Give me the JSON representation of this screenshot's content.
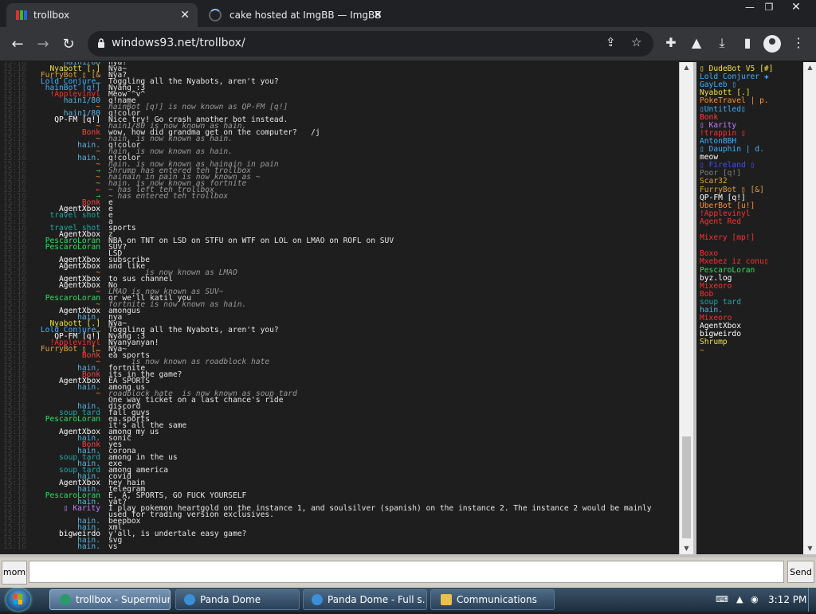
{
  "browser": {
    "tabs": [
      {
        "title": "trollbox",
        "active": true
      },
      {
        "title": "cake hosted at ImgBB — ImgBB",
        "active": false
      }
    ],
    "url": "windows93.net/trollbox/"
  },
  "chat": {
    "timestamp_placeholder": "15:16",
    "messages": [
      {
        "nick": "hain1/80",
        "color": "#5ab4e0",
        "text": "nya!"
      },
      {
        "nick": "Nyabott [.]",
        "color": "#f0e040",
        "text": "Nya~"
      },
      {
        "nick": "FurryBot ▯ [&",
        "color": "#e0a040",
        "text": "Nya?"
      },
      {
        "nick": "Lold Conjure…",
        "color": "#40b0ff",
        "text": "Toggling all the Nyabots, aren't you?"
      },
      {
        "nick": "hainBot [q!]",
        "color": "#40b0ff",
        "text": "Nyang :3"
      },
      {
        "nick": "!Applevinyl",
        "color": "#ff3030",
        "text": "Meow ^v^"
      },
      {
        "nick": "hain1/80",
        "color": "#5ab4e0",
        "text": "q!name"
      },
      {
        "nick": "~",
        "color": "#ff8c2a",
        "text": "hainBot [q!] is now known as QP-FM [q!]",
        "system": true
      },
      {
        "nick": "hain1/80",
        "color": "#5ab4e0",
        "text": "q!color"
      },
      {
        "nick": "QP-FM [q!]",
        "color": "#ffffff",
        "text": "Nice try! Go crash another bot instead."
      },
      {
        "nick": "~",
        "color": "#ff8c2a",
        "text": "hain1/80 is now known as hain.",
        "system": true
      },
      {
        "nick": "Bonk",
        "color": "#ff4040",
        "text": "wow, how did grandma get on the computer?   /j"
      },
      {
        "nick": "~",
        "color": "#ff8c2a",
        "text": "hain. is now known as hain.",
        "system": true
      },
      {
        "nick": "hain.",
        "color": "#5ab4e0",
        "text": "q!color"
      },
      {
        "nick": "~",
        "color": "#ff8c2a",
        "text": "hain. is now known as hain.",
        "system": true
      },
      {
        "nick": "hain.",
        "color": "#5ab4e0",
        "text": "q!color"
      },
      {
        "nick": "~",
        "color": "#ff8c2a",
        "text": "hain. is now known as hainain in pain",
        "system": true
      },
      {
        "nick": "→",
        "color": "#40d040",
        "text": "Shrump has entered teh trollbox",
        "system": true
      },
      {
        "nick": "~",
        "color": "#ff8c2a",
        "text": "hainain in pain is now known as ~",
        "system": true
      },
      {
        "nick": "~",
        "color": "#ff8c2a",
        "text": "hain. is now known as fortnite",
        "system": true
      },
      {
        "nick": "←",
        "color": "#ff4040",
        "text": "~ has left teh trollbox",
        "system": true
      },
      {
        "nick": "→",
        "color": "#40d040",
        "text": "~ has entered teh trollbox",
        "system": true
      },
      {
        "nick": "Bonk",
        "color": "#ff4040",
        "text": "e"
      },
      {
        "nick": "AgentXbox",
        "color": "#ffffff",
        "text": "e"
      },
      {
        "nick": "travel shot",
        "color": "#20a8a8",
        "text": "e"
      },
      {
        "nick": "",
        "color": "#3050e0",
        "text": "a"
      },
      {
        "nick": "travel shot",
        "color": "#20a8a8",
        "text": "sports"
      },
      {
        "nick": "AgentXbox",
        "color": "#ffffff",
        "text": "z"
      },
      {
        "nick": "PescaroLoran",
        "color": "#30e060",
        "text": "NBA on TNT on LSD on STFU on WTF on LOL on LMAO on ROFL on SUV"
      },
      {
        "nick": "PescaroLoran",
        "color": "#30e060",
        "text": "SUV?"
      },
      {
        "nick": "",
        "color": "#3050e0",
        "text": "LSD"
      },
      {
        "nick": "AgentXbox",
        "color": "#ffffff",
        "text": "subscribe"
      },
      {
        "nick": "AgentXbox",
        "color": "#ffffff",
        "text": "and like"
      },
      {
        "nick": "~",
        "color": "#ff8c2a",
        "text": "        is now known as LMAO",
        "system": true
      },
      {
        "nick": "AgentXbox",
        "color": "#ffffff",
        "text": "to sus channel"
      },
      {
        "nick": "AgentXbox",
        "color": "#ffffff",
        "text": "No"
      },
      {
        "nick": "~",
        "color": "#ff8c2a",
        "text": "LMAO is now known as SUV~",
        "system": true
      },
      {
        "nick": "PescaroLoran",
        "color": "#30e060",
        "text": "or we'll katil you"
      },
      {
        "nick": "~",
        "color": "#ff8c2a",
        "text": "fortnite is now known as hain.",
        "system": true
      },
      {
        "nick": "AgentXbox",
        "color": "#ffffff",
        "text": "amongus"
      },
      {
        "nick": "hain.",
        "color": "#5ab4e0",
        "text": "nya"
      },
      {
        "nick": "Nyabott [.]",
        "color": "#f0e040",
        "text": "Nya~"
      },
      {
        "nick": "Lold Conjure…",
        "color": "#40b0ff",
        "text": "Toggling all the Nyabots, aren't you?"
      },
      {
        "nick": "QP-FM [q!]",
        "color": "#ffffff",
        "text": "Nyang :3"
      },
      {
        "nick": "!Applevinyl",
        "color": "#ff3030",
        "text": "Nyanyanyan!"
      },
      {
        "nick": "FurryBot ▯ […",
        "color": "#e0a040",
        "text": "Nya~"
      },
      {
        "nick": "Bonk",
        "color": "#ff4040",
        "text": "ea sports"
      },
      {
        "nick": "~",
        "color": "#ff8c2a",
        "text": "     is now known as roadblock hate",
        "system": true
      },
      {
        "nick": "hain.",
        "color": "#5ab4e0",
        "text": "fortnite"
      },
      {
        "nick": "Bonk",
        "color": "#ff4040",
        "text": "its in the game?"
      },
      {
        "nick": "AgentXbox",
        "color": "#ffffff",
        "text": "EA SPORTS"
      },
      {
        "nick": "hain.",
        "color": "#5ab4e0",
        "text": "among us"
      },
      {
        "nick": "~",
        "color": "#ff8c2a",
        "text": "roadblock hate  is now known as soup tard",
        "system": true
      },
      {
        "nick": "",
        "color": "#3050e0",
        "text": "One way ticket on a last chance's ride"
      },
      {
        "nick": "hain.",
        "color": "#5ab4e0",
        "text": "discord"
      },
      {
        "nick": "soup tard",
        "color": "#20a8a8",
        "text": "fall guys"
      },
      {
        "nick": "PescaroLoran",
        "color": "#30e060",
        "text": "ea.sports"
      },
      {
        "nick": "",
        "color": "#3050e0",
        "text": "it's all the same"
      },
      {
        "nick": "AgentXbox",
        "color": "#ffffff",
        "text": "among my us"
      },
      {
        "nick": "hain.",
        "color": "#5ab4e0",
        "text": "sonic"
      },
      {
        "nick": "Bonk",
        "color": "#ff4040",
        "text": "yes"
      },
      {
        "nick": "hain.",
        "color": "#5ab4e0",
        "text": "corona"
      },
      {
        "nick": "soup tard",
        "color": "#20a8a8",
        "text": "among in the us"
      },
      {
        "nick": "hain.",
        "color": "#5ab4e0",
        "text": "exe"
      },
      {
        "nick": "soup tard",
        "color": "#20a8a8",
        "text": "among america"
      },
      {
        "nick": "hain.",
        "color": "#5ab4e0",
        "text": "covid"
      },
      {
        "nick": "AgentXbox",
        "color": "#ffffff",
        "text": "hey hain"
      },
      {
        "nick": "hain.",
        "color": "#5ab4e0",
        "text": "telegram"
      },
      {
        "nick": "PescaroLoran",
        "color": "#30e060",
        "text": "E, A, SPORTS, GO FUCK YOURSELF"
      },
      {
        "nick": "hain.",
        "color": "#5ab4e0",
        "text": "yat?"
      },
      {
        "nick": "▯ Karity",
        "color": "#c080ff",
        "text": "I play pokemon heartgold on the instance 1, and soulsilver (spanish) on the instance 2. The instance 2 would be mainly"
      },
      {
        "nick": "",
        "color": "#c080ff",
        "text": "used for trading version exclusives."
      },
      {
        "nick": "hain.",
        "color": "#5ab4e0",
        "text": "beepbox"
      },
      {
        "nick": "hain.",
        "color": "#5ab4e0",
        "text": "xml"
      },
      {
        "nick": "bigweirdo",
        "color": "#ffffff",
        "text": "y'all, is undertale easy game?"
      },
      {
        "nick": "hain.",
        "color": "#5ab4e0",
        "text": "svg"
      },
      {
        "nick": "hain.",
        "color": "#5ab4e0",
        "text": "vs"
      }
    ]
  },
  "users": [
    {
      "name": "▯ DudeBot V5 [#]",
      "color": "#f0e040"
    },
    {
      "name": "Lold Conjurer ✚",
      "color": "#40b0ff"
    },
    {
      "name": "GayLeb ▯",
      "color": "#40b0ff"
    },
    {
      "name": "Nyabott [.]",
      "color": "#f0e040"
    },
    {
      "name": "PokeTravel | p.",
      "color": "#ff9030"
    },
    {
      "name": "▯Untitled▯",
      "color": "#40b0ff"
    },
    {
      "name": "Bonk",
      "color": "#ff4040"
    },
    {
      "name": "▯ Karity",
      "color": "#c080ff"
    },
    {
      "name": "!trappin ▯",
      "color": "#ff3030"
    },
    {
      "name": "AntonBBH",
      "color": "#40b0ff"
    },
    {
      "name": "▯ Dauphin | d.",
      "color": "#40b0ff"
    },
    {
      "name": "meow",
      "color": "#ffffff"
    },
    {
      "name": "▯ Fireland ▯",
      "color": "#4050ff"
    },
    {
      "name": "Poor [q!]",
      "color": "#808080"
    },
    {
      "name": "Scar32",
      "color": "#e0a040"
    },
    {
      "name": "FurryBot ▯ [&]",
      "color": "#e0a040"
    },
    {
      "name": "QP-FM [q!]",
      "color": "#ffffff"
    },
    {
      "name": "UberBot [u!]",
      "color": "#ff9030"
    },
    {
      "name": "!Applevinyl",
      "color": "#ff3030"
    },
    {
      "name": "Agent Red",
      "color": "#ff3030"
    },
    {
      "name": "",
      "color": "#30e060"
    },
    {
      "name": "Mixery [mp!]",
      "color": "#ff3030"
    },
    {
      "name": "",
      "color": "#3050e0"
    },
    {
      "name": "Boxo",
      "color": "#ff3030"
    },
    {
      "name": "Mxebez iz conu▯",
      "color": "#ff3030"
    },
    {
      "name": "PescaroLoran",
      "color": "#30e060"
    },
    {
      "name": "byz.log",
      "color": "#ffffff"
    },
    {
      "name": "Mixeoro",
      "color": "#ff3030"
    },
    {
      "name": "Bob",
      "color": "#ff3030"
    },
    {
      "name": "soup tard",
      "color": "#20a8a8"
    },
    {
      "name": "hain.",
      "color": "#5ab4e0"
    },
    {
      "name": "Mixeoro",
      "color": "#ff3030"
    },
    {
      "name": "AgentXbox",
      "color": "#ffffff"
    },
    {
      "name": "bigweirdo",
      "color": "#ffffff"
    },
    {
      "name": "Shrump",
      "color": "#f0e040"
    },
    {
      "name": "~",
      "color": "#ff8c2a"
    }
  ],
  "input": {
    "nick_label": "mom",
    "placeholder": "",
    "send_label": "Send"
  },
  "taskbar": {
    "items": [
      {
        "label": "trollbox - Supermium",
        "active": true
      },
      {
        "label": "Panda Dome",
        "active": false
      },
      {
        "label": "Panda Dome - Full s…",
        "active": false
      },
      {
        "label": "Communications",
        "active": false
      }
    ],
    "clock": "3:12 PM"
  },
  "colors": {
    "chat_background": "#1e1e1e",
    "browser_frame": "#202124",
    "browser_toolbar": "#35363a"
  }
}
